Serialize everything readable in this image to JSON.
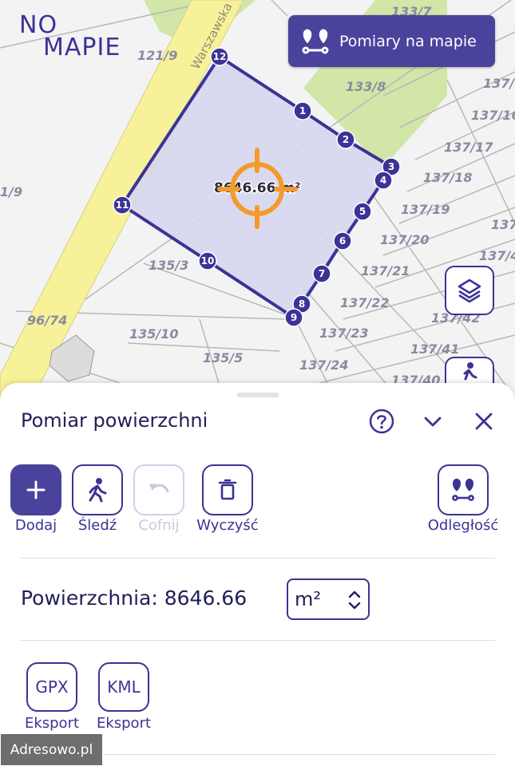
{
  "app": {
    "logo_top": "NO",
    "logo_bottom": "MAPIE"
  },
  "map": {
    "street": "Warszawska",
    "area_overlay": "8646.66 m²",
    "parcels": [
      "133/7",
      "121/9",
      "133/8",
      "137/",
      "137/16",
      "137/17",
      "137/18",
      "137/19",
      "137/20",
      "137/21",
      "137/22",
      "137/23",
      "137/24",
      "137/41",
      "137/42",
      "137/40",
      "137/4",
      "137",
      "135/3",
      "135/10",
      "135/5",
      "96/74",
      "1/9"
    ],
    "vertices": [
      "1",
      "2",
      "3",
      "4",
      "5",
      "6",
      "7",
      "8",
      "9",
      "10",
      "11",
      "12"
    ]
  },
  "measure_button": {
    "label": "Pomiary na mapie",
    "icon": "route-pins-icon"
  },
  "map_controls": {
    "layers_icon": "layers-icon",
    "walk_icon": "person-walk-icon"
  },
  "panel": {
    "title": "Pomiar powierzchni",
    "tools": [
      {
        "label": "Dodaj",
        "icon": "plus-icon"
      },
      {
        "label": "Śledź",
        "icon": "person-walk-icon"
      },
      {
        "label": "Cofnij",
        "icon": "undo-icon"
      },
      {
        "label": "Wyczyść",
        "icon": "trash-icon"
      },
      {
        "label": "Odległość",
        "icon": "route-pins-icon"
      }
    ],
    "area_label": "Powierzchnia:",
    "area_value": "8646.66",
    "unit": "m²",
    "exports": [
      {
        "format": "GPX",
        "label": "Eksport"
      },
      {
        "format": "KML",
        "label": "Eksport"
      }
    ]
  },
  "watermark": "Adresowo.pl",
  "colors": {
    "accent": "#4a439b",
    "polygon_fill": "#d6d6ee",
    "road": "#f7f19a",
    "green": "#d2e6a8",
    "target": "#f39a2b"
  }
}
